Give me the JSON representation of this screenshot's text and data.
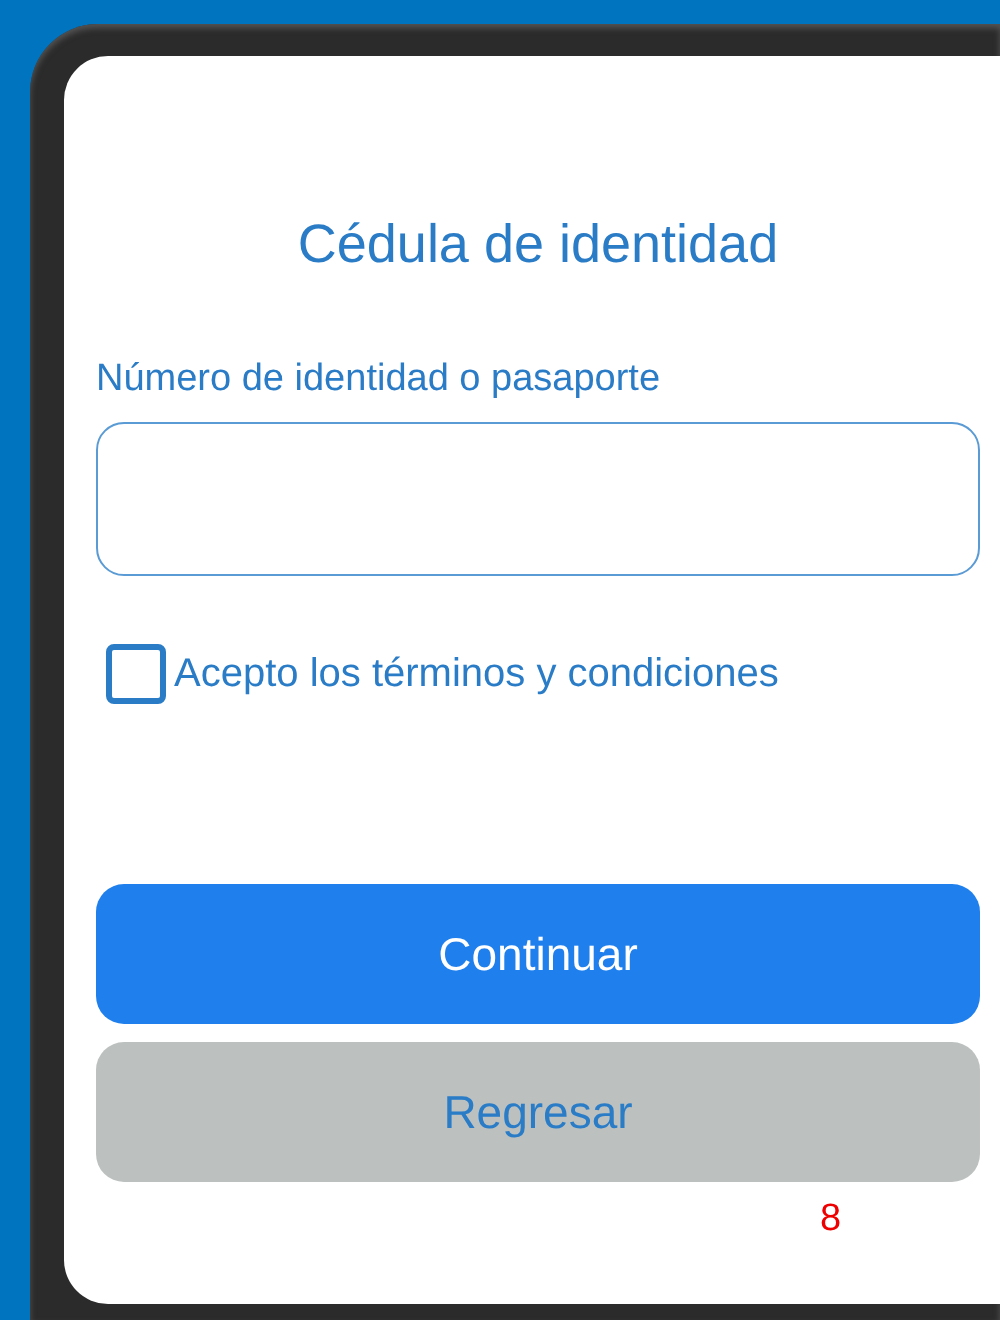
{
  "screen": {
    "title": "Cédula de identidad",
    "id_field": {
      "label": "Número de identidad o pasaporte"
    },
    "terms": {
      "label": "Acepto los términos y condiciones",
      "checked": false
    },
    "buttons": [
      {
        "kind": "primary",
        "label": "Continuar"
      },
      {
        "kind": "secondary",
        "label": "Regresar"
      }
    ],
    "page_number": "8"
  }
}
